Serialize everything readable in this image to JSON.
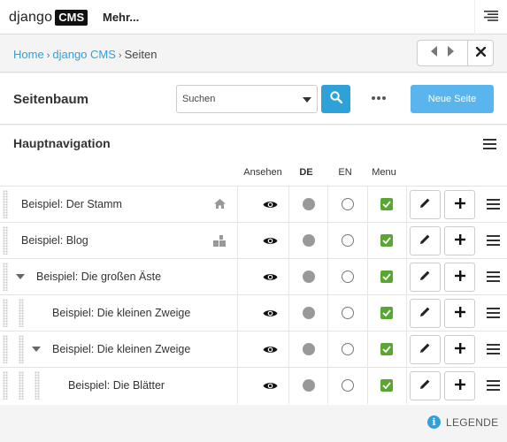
{
  "toolbar": {
    "logo_text": "django",
    "logo_badge": "CMS",
    "more_label": "Mehr..."
  },
  "breadcrumb": {
    "items": [
      "Home",
      "django CMS",
      "Seiten"
    ],
    "separator": "›"
  },
  "header": {
    "title": "Seitenbaum",
    "search_placeholder": "Suchen",
    "new_page_label": "Neue Seite"
  },
  "navigation": {
    "title": "Hauptnavigation",
    "columns": [
      "Ansehen",
      "DE",
      "EN",
      "Menu"
    ]
  },
  "rows": [
    {
      "label": "Beispiel: Der Stamm",
      "level": 0,
      "expanded": null,
      "type_icon": "home-icon",
      "de_published": true,
      "en_published": false,
      "in_menu": true
    },
    {
      "label": "Beispiel: Blog",
      "level": 0,
      "expanded": null,
      "type_icon": "apphook-icon",
      "de_published": true,
      "en_published": false,
      "in_menu": true
    },
    {
      "label": "Beispiel: Die großen Äste",
      "level": 0,
      "expanded": true,
      "type_icon": null,
      "de_published": true,
      "en_published": false,
      "in_menu": true
    },
    {
      "label": "Beispiel: Die kleinen Zweige",
      "level": 1,
      "expanded": null,
      "type_icon": null,
      "de_published": true,
      "en_published": false,
      "in_menu": true
    },
    {
      "label": "Beispiel: Die kleinen Zweige",
      "level": 1,
      "expanded": true,
      "type_icon": null,
      "de_published": true,
      "en_published": false,
      "in_menu": true
    },
    {
      "label": "Beispiel: Die Blätter",
      "level": 2,
      "expanded": null,
      "type_icon": null,
      "de_published": true,
      "en_published": false,
      "in_menu": true
    }
  ],
  "legend": {
    "label": "LEGENDE"
  },
  "colors": {
    "accent": "#2ea1d9",
    "new_page_button": "#5ab5ef",
    "menu_check": "#5aa632",
    "published_dot": "#999999"
  }
}
